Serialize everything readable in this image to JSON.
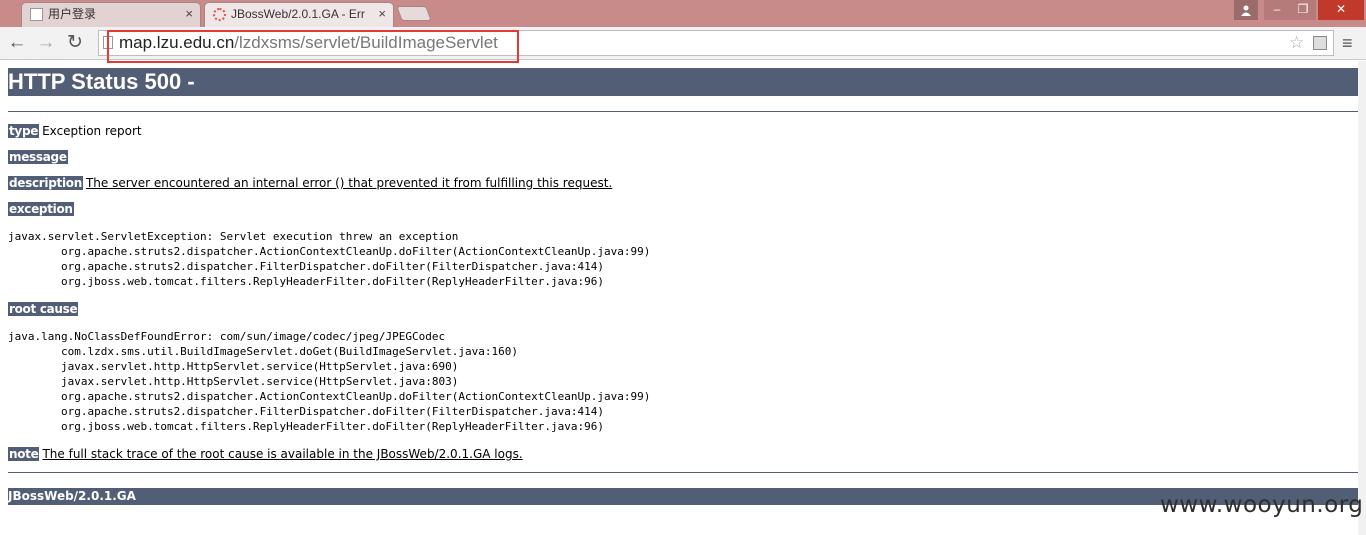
{
  "browser": {
    "tabs": [
      {
        "label": "用户登录",
        "close": "×"
      },
      {
        "label": "JBossWeb/2.0.1.GA - Err",
        "close": "×"
      }
    ],
    "window_controls": {
      "minimize": "–",
      "maximize": "❐",
      "close": "✕"
    },
    "nav": {
      "back": "←",
      "forward": "→",
      "reload": "↻"
    },
    "url_host": "map.lzu.edu.cn",
    "url_path": "/lzdxsms/servlet/BuildImageServlet",
    "star": "☆",
    "menu": "≡"
  },
  "page": {
    "title": "HTTP Status 500 -",
    "type_label": "type",
    "type_value": "Exception report",
    "message_label": "message",
    "description_label": "description",
    "description_value": "The server encountered an internal error () that prevented it from fulfilling this request.",
    "exception_label": "exception",
    "exception_trace": "javax.servlet.ServletException: Servlet execution threw an exception\n\torg.apache.struts2.dispatcher.ActionContextCleanUp.doFilter(ActionContextCleanUp.java:99)\n\torg.apache.struts2.dispatcher.FilterDispatcher.doFilter(FilterDispatcher.java:414)\n\torg.jboss.web.tomcat.filters.ReplyHeaderFilter.doFilter(ReplyHeaderFilter.java:96)",
    "root_cause_label": "root cause",
    "root_cause_trace": "java.lang.NoClassDefFoundError: com/sun/image/codec/jpeg/JPEGCodec\n\tcom.lzdx.sms.util.BuildImageServlet.doGet(BuildImageServlet.java:160)\n\tjavax.servlet.http.HttpServlet.service(HttpServlet.java:690)\n\tjavax.servlet.http.HttpServlet.service(HttpServlet.java:803)\n\torg.apache.struts2.dispatcher.ActionContextCleanUp.doFilter(ActionContextCleanUp.java:99)\n\torg.apache.struts2.dispatcher.FilterDispatcher.doFilter(FilterDispatcher.java:414)\n\torg.jboss.web.tomcat.filters.ReplyHeaderFilter.doFilter(ReplyHeaderFilter.java:96)",
    "note_label": "note",
    "note_value": "The full stack trace of the root cause is available in the JBossWeb/2.0.1.GA logs.",
    "footer": "JBossWeb/2.0.1.GA"
  },
  "watermark": "www.wooyun.org",
  "colors": {
    "header_bg": "#525d76",
    "highlight_border": "#e53935"
  }
}
